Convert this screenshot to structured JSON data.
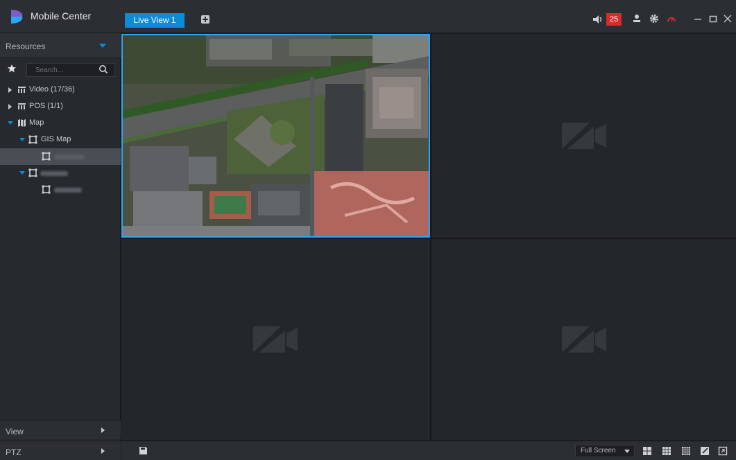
{
  "app": {
    "title": "Mobile Center"
  },
  "tabs": [
    {
      "label": "Live View 1"
    }
  ],
  "toolbar": {
    "alarm_count": "25"
  },
  "resources": {
    "header": "Resources",
    "search_placeholder": "Search...",
    "tree": [
      {
        "label": "Video (17/36)"
      },
      {
        "label": "POS (1/1)"
      },
      {
        "label": "Map"
      },
      {
        "label": "GIS Map"
      }
    ]
  },
  "sections": {
    "view": "View",
    "ptz": "PTZ"
  },
  "bottom": {
    "fullscreen_label": "Full Screen"
  },
  "colors": {
    "accent": "#0e8ad6",
    "alarm": "#d92b2b",
    "selected_border": "#2aa6f2"
  }
}
